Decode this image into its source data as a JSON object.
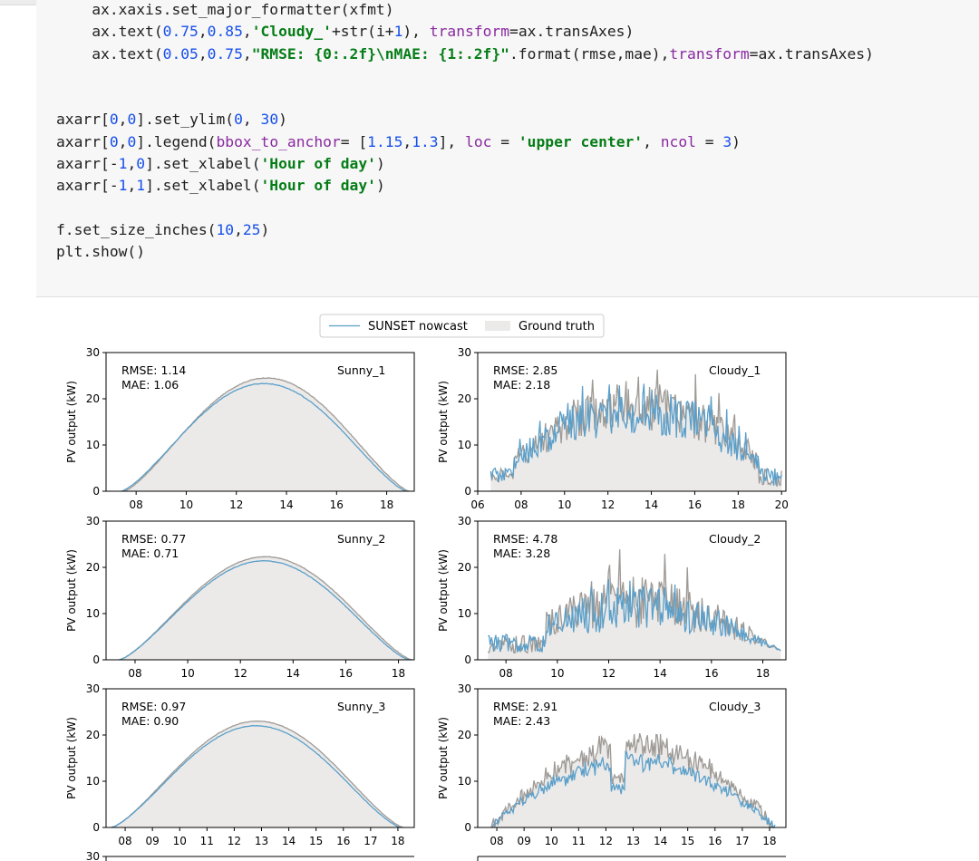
{
  "code": {
    "lines": [
      {
        "indent": "    ",
        "segments": [
          {
            "t": "ax.xaxis.set_major_formatter(xfmt)",
            "c": ""
          }
        ]
      },
      {
        "indent": "    ",
        "segments": [
          {
            "t": "ax.text(",
            "c": ""
          },
          {
            "t": "0.75",
            "c": "num"
          },
          {
            "t": ",",
            "c": ""
          },
          {
            "t": "0.85",
            "c": "num"
          },
          {
            "t": ",",
            "c": ""
          },
          {
            "t": "'Cloudy_'",
            "c": "str"
          },
          {
            "t": "+str(i+",
            "c": ""
          },
          {
            "t": "1",
            "c": "num"
          },
          {
            "t": "), ",
            "c": ""
          },
          {
            "t": "transform",
            "c": "kw"
          },
          {
            "t": "=ax.transAxes)",
            "c": ""
          }
        ]
      },
      {
        "indent": "    ",
        "segments": [
          {
            "t": "ax.text(",
            "c": ""
          },
          {
            "t": "0.05",
            "c": "num"
          },
          {
            "t": ",",
            "c": ""
          },
          {
            "t": "0.75",
            "c": "num"
          },
          {
            "t": ",",
            "c": ""
          },
          {
            "t": "\"RMSE: {0:.2f}\\nMAE: {1:.2f}\"",
            "c": "str"
          },
          {
            "t": ".format(rmse,mae),",
            "c": ""
          },
          {
            "t": "transform",
            "c": "kw"
          },
          {
            "t": "=ax.transAxes)",
            "c": ""
          }
        ]
      },
      {
        "indent": "",
        "segments": []
      },
      {
        "indent": "",
        "segments": []
      },
      {
        "indent": "",
        "segments": [
          {
            "t": "axarr[",
            "c": ""
          },
          {
            "t": "0",
            "c": "num"
          },
          {
            "t": ",",
            "c": ""
          },
          {
            "t": "0",
            "c": "num"
          },
          {
            "t": "].set_ylim(",
            "c": ""
          },
          {
            "t": "0",
            "c": "num"
          },
          {
            "t": ", ",
            "c": ""
          },
          {
            "t": "30",
            "c": "num"
          },
          {
            "t": ")",
            "c": ""
          }
        ]
      },
      {
        "indent": "",
        "segments": [
          {
            "t": "axarr[",
            "c": ""
          },
          {
            "t": "0",
            "c": "num"
          },
          {
            "t": ",",
            "c": ""
          },
          {
            "t": "0",
            "c": "num"
          },
          {
            "t": "].legend(",
            "c": ""
          },
          {
            "t": "bbox_to_anchor",
            "c": "kw"
          },
          {
            "t": "= [",
            "c": ""
          },
          {
            "t": "1.15",
            "c": "num"
          },
          {
            "t": ",",
            "c": ""
          },
          {
            "t": "1.3",
            "c": "num"
          },
          {
            "t": "], ",
            "c": ""
          },
          {
            "t": "loc",
            "c": "kw"
          },
          {
            "t": " = ",
            "c": ""
          },
          {
            "t": "'upper center'",
            "c": "str"
          },
          {
            "t": ", ",
            "c": ""
          },
          {
            "t": "ncol",
            "c": "kw"
          },
          {
            "t": " = ",
            "c": ""
          },
          {
            "t": "3",
            "c": "num"
          },
          {
            "t": ")",
            "c": ""
          }
        ]
      },
      {
        "indent": "",
        "segments": [
          {
            "t": "axarr[-",
            "c": ""
          },
          {
            "t": "1",
            "c": "num"
          },
          {
            "t": ",",
            "c": ""
          },
          {
            "t": "0",
            "c": "num"
          },
          {
            "t": "].set_xlabel(",
            "c": ""
          },
          {
            "t": "'Hour of day'",
            "c": "str"
          },
          {
            "t": ")",
            "c": ""
          }
        ]
      },
      {
        "indent": "",
        "segments": [
          {
            "t": "axarr[-",
            "c": ""
          },
          {
            "t": "1",
            "c": "num"
          },
          {
            "t": ",",
            "c": ""
          },
          {
            "t": "1",
            "c": "num"
          },
          {
            "t": "].set_xlabel(",
            "c": ""
          },
          {
            "t": "'Hour of day'",
            "c": "str"
          },
          {
            "t": ")",
            "c": ""
          }
        ]
      },
      {
        "indent": "",
        "segments": []
      },
      {
        "indent": "",
        "segments": [
          {
            "t": "f.set_size_inches(",
            "c": ""
          },
          {
            "t": "10",
            "c": "num"
          },
          {
            "t": ",",
            "c": ""
          },
          {
            "t": "25",
            "c": "num"
          },
          {
            "t": ")",
            "c": ""
          }
        ]
      },
      {
        "indent": "",
        "segments": [
          {
            "t": "plt.show()",
            "c": ""
          }
        ]
      }
    ]
  },
  "colors": {
    "nowcast": "#5b9fc9",
    "ground_truth_line": "#9e9a96",
    "ground_truth_fill": "#ebeae9",
    "code_bg": "#f7f7f7",
    "keyword": "#8a2aa0",
    "number": "#1750eb",
    "string": "#067d17"
  },
  "legend": {
    "items": [
      "SUNSET nowcast",
      "Ground truth"
    ]
  },
  "chart_data": [
    {
      "type": "area",
      "title": "Sunny_1",
      "ylabel": "PV output (kW)",
      "xlabel": "",
      "ylim": [
        0,
        30
      ],
      "xlim": [
        6.8,
        19.1
      ],
      "xticks": [
        8,
        10,
        12,
        14,
        16,
        18
      ],
      "xtick_labels": [
        "08",
        "10",
        "12",
        "14",
        "16",
        "18"
      ],
      "yticks": [
        0,
        10,
        20,
        30
      ],
      "annotation": {
        "rmse": "RMSE: 1.14",
        "mae": "MAE: 1.06"
      },
      "series": [
        {
          "name": "Ground truth",
          "shape": "bell",
          "start": 7.5,
          "end": 18.9,
          "peak": 24.5,
          "peak_x": 13.4,
          "noise": 0.15
        },
        {
          "name": "SUNSET nowcast",
          "shape": "bell",
          "start": 7.4,
          "end": 18.8,
          "peak": 23.3,
          "peak_x": 13.4,
          "noise": 0.12
        }
      ],
      "x": [
        8,
        10,
        12,
        14,
        16,
        18
      ],
      "values_ground_truth": [
        2.5,
        13.2,
        21.5,
        24.2,
        18.8,
        5.8
      ],
      "values_nowcast": [
        2.3,
        12.6,
        20.5,
        23.1,
        17.9,
        5.4
      ],
      "grid": false
    },
    {
      "type": "area",
      "title": "Cloudy_1",
      "ylabel": "PV output (kW)",
      "xlabel": "",
      "ylim": [
        0,
        30
      ],
      "xlim": [
        6,
        20.2
      ],
      "xticks": [
        6,
        8,
        10,
        12,
        14,
        16,
        18,
        20
      ],
      "xtick_labels": [
        "06",
        "08",
        "10",
        "12",
        "14",
        "16",
        "18",
        "20"
      ],
      "yticks": [
        0,
        10,
        20,
        30
      ],
      "annotation": {
        "rmse": "RMSE: 2.85",
        "mae": "MAE: 2.18"
      },
      "series": [
        {
          "name": "Ground truth",
          "shape": "cloudy",
          "start": 6.6,
          "end": 20.0,
          "peak": 24,
          "peak_x": 13.2,
          "noise": 7
        },
        {
          "name": "SUNSET nowcast",
          "shape": "cloudy",
          "start": 6.6,
          "end": 20.0,
          "peak": 22.5,
          "peak_x": 13.2,
          "noise": 5
        }
      ],
      "x": [
        8,
        10,
        12,
        14,
        16,
        18,
        20
      ],
      "values_ground_truth": [
        6,
        13,
        24,
        26,
        14,
        8,
        0
      ],
      "values_nowcast": [
        5,
        12,
        21,
        24,
        13,
        8,
        1
      ],
      "grid": false
    },
    {
      "type": "area",
      "title": "Sunny_2",
      "ylabel": "PV output (kW)",
      "xlabel": "",
      "ylim": [
        0,
        30
      ],
      "xlim": [
        6.9,
        18.6
      ],
      "xticks": [
        8,
        10,
        12,
        14,
        16,
        18
      ],
      "xtick_labels": [
        "08",
        "10",
        "12",
        "14",
        "16",
        "18"
      ],
      "yticks": [
        0,
        10,
        20,
        30
      ],
      "annotation": {
        "rmse": "RMSE: 0.77",
        "mae": "MAE: 0.71"
      },
      "series": [
        {
          "name": "Ground truth",
          "shape": "bell",
          "start": 7.4,
          "end": 18.5,
          "peak": 22.3,
          "peak_x": 13.0,
          "noise": 0.1
        },
        {
          "name": "SUNSET nowcast",
          "shape": "bell",
          "start": 7.4,
          "end": 18.4,
          "peak": 21.4,
          "peak_x": 13.0,
          "noise": 0.1
        }
      ],
      "x": [
        8,
        10,
        12,
        14,
        16,
        18
      ],
      "values_ground_truth": [
        3,
        14,
        21.5,
        21.5,
        14,
        2.5
      ],
      "values_nowcast": [
        2.8,
        13.5,
        20.7,
        20.7,
        13.4,
        2.3
      ],
      "grid": false
    },
    {
      "type": "area",
      "title": "Cloudy_2",
      "ylabel": "PV output (kW)",
      "xlabel": "",
      "ylim": [
        0,
        30
      ],
      "xlim": [
        6.9,
        18.9
      ],
      "xticks": [
        8,
        10,
        12,
        14,
        16,
        18
      ],
      "xtick_labels": [
        "08",
        "10",
        "12",
        "14",
        "16",
        "18"
      ],
      "yticks": [
        0,
        10,
        20,
        30
      ],
      "annotation": {
        "rmse": "RMSE: 4.78",
        "mae": "MAE: 3.28"
      },
      "series": [
        {
          "name": "Ground truth",
          "shape": "volatile",
          "start": 7.3,
          "end": 18.7,
          "peak": 16,
          "peak_x": 13.0,
          "noise": 12
        },
        {
          "name": "SUNSET nowcast",
          "shape": "volatile",
          "start": 7.3,
          "end": 18.7,
          "peak": 14,
          "peak_x": 13.0,
          "noise": 8
        }
      ],
      "x": [
        8,
        10,
        12,
        14,
        16,
        18
      ],
      "values_ground_truth": [
        3,
        4,
        16,
        20,
        9,
        3
      ],
      "values_nowcast": [
        3,
        4,
        14,
        17,
        8,
        3
      ],
      "grid": false
    },
    {
      "type": "area",
      "title": "Sunny_3",
      "ylabel": "PV output (kW)",
      "xlabel": "",
      "ylim": [
        0,
        30
      ],
      "xlim": [
        7.3,
        18.6
      ],
      "xticks": [
        8,
        9,
        10,
        11,
        12,
        13,
        14,
        15,
        16,
        17,
        18
      ],
      "xtick_labels": [
        "08",
        "09",
        "10",
        "11",
        "12",
        "13",
        "14",
        "15",
        "16",
        "17",
        "18"
      ],
      "yticks": [
        0,
        10,
        20,
        30
      ],
      "annotation": {
        "rmse": "RMSE: 0.97",
        "mae": "MAE: 0.90"
      },
      "series": [
        {
          "name": "Ground truth",
          "shape": "bell",
          "start": 7.5,
          "end": 18.2,
          "peak": 23.0,
          "peak_x": 13.0,
          "noise": 0.1
        },
        {
          "name": "SUNSET nowcast",
          "shape": "bell",
          "start": 7.5,
          "end": 18.1,
          "peak": 22.0,
          "peak_x": 13.0,
          "noise": 0.1
        }
      ],
      "x": [
        8,
        10,
        12,
        14,
        16,
        18
      ],
      "values_ground_truth": [
        3,
        14.5,
        22,
        21.8,
        14,
        1.2
      ],
      "values_nowcast": [
        2.8,
        13.8,
        21,
        20.9,
        13.3,
        1.0
      ],
      "grid": false
    },
    {
      "type": "area",
      "title": "Cloudy_3",
      "ylabel": "PV output (kW)",
      "xlabel": "",
      "ylim": [
        0,
        30
      ],
      "xlim": [
        7.3,
        18.6
      ],
      "xticks": [
        8,
        9,
        10,
        11,
        12,
        13,
        14,
        15,
        16,
        17,
        18
      ],
      "xtick_labels": [
        "08",
        "09",
        "10",
        "11",
        "12",
        "13",
        "14",
        "15",
        "16",
        "17",
        "18"
      ],
      "yticks": [
        0,
        10,
        20,
        30
      ],
      "annotation": {
        "rmse": "RMSE: 2.91",
        "mae": "MAE: 2.43"
      },
      "series": [
        {
          "name": "Ground truth",
          "shape": "cloudy3",
          "start": 7.8,
          "end": 18.2,
          "peak": 20,
          "peak_x": 13.5,
          "noise": 3
        },
        {
          "name": "SUNSET nowcast",
          "shape": "cloudy3",
          "start": 7.8,
          "end": 18.2,
          "peak": 16,
          "peak_x": 13.5,
          "noise": 2
        }
      ],
      "x": [
        8,
        10,
        12,
        14,
        16,
        18
      ],
      "values_ground_truth": [
        1,
        13,
        17,
        20,
        14,
        0.5
      ],
      "values_nowcast": [
        1,
        11,
        12,
        17,
        11,
        0.5
      ],
      "grid": false
    }
  ],
  "partial_row": {
    "ytick_label": "30"
  }
}
